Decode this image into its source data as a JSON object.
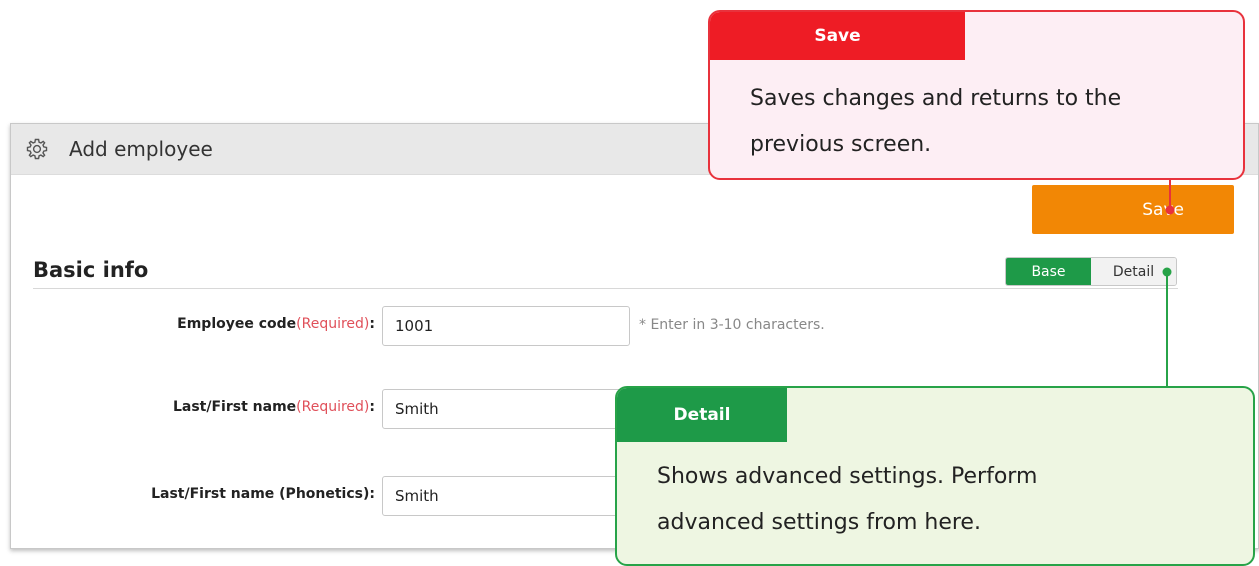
{
  "window": {
    "title": "Add employee",
    "save_label": "Save"
  },
  "section": {
    "title": "Basic info",
    "tabs": [
      {
        "label": "Base",
        "active": true
      },
      {
        "label": "Detail",
        "active": false
      }
    ]
  },
  "form": {
    "rows": [
      {
        "label": "Employee code",
        "required": "(Required)",
        "colon": ":",
        "value": "1001",
        "hint": "* Enter in 3-10 characters."
      },
      {
        "label": "Last/First name",
        "required": "(Required)",
        "colon": ":",
        "value": "Smith",
        "hint": ""
      },
      {
        "label": "Last/First name (Phonetics)",
        "required": "",
        "colon": ":",
        "value": "Smith",
        "hint": ""
      }
    ]
  },
  "callouts": {
    "save": {
      "tag": "Save",
      "line1": "Saves changes and returns to the",
      "line2": "previous screen."
    },
    "detail": {
      "tag": "Detail",
      "line1": "Shows advanced settings. Perform",
      "line2": "advanced settings from here."
    }
  },
  "colors": {
    "save_button": "#f28705",
    "base_tab": "#1e9a48",
    "required_text": "#e0505a",
    "save_callout_border": "#e8323c",
    "detail_callout_border": "#27a348"
  },
  "icons": {
    "title": "gear-icon"
  }
}
